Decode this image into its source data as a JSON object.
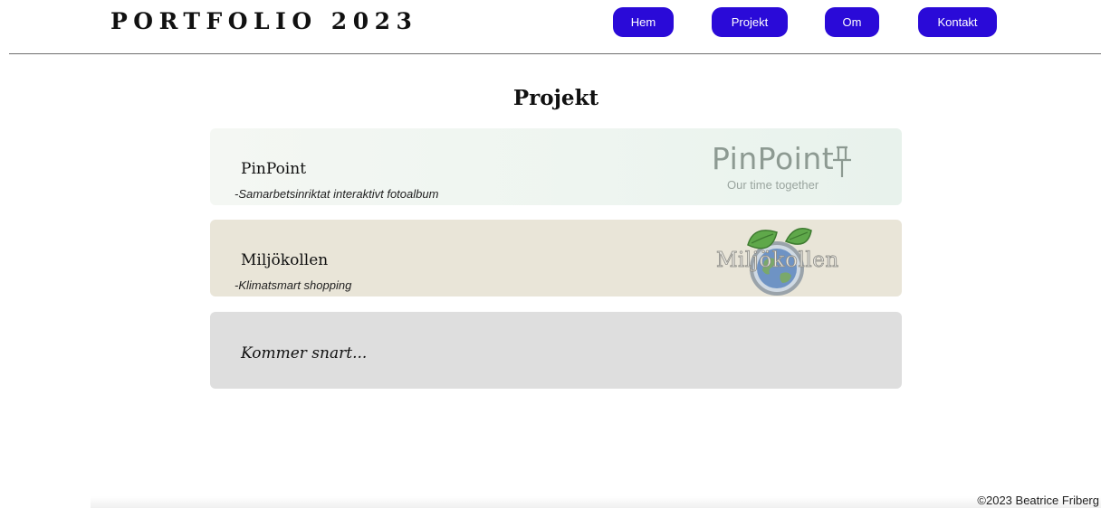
{
  "header": {
    "site_title": "PORTFOLIO 2023",
    "nav": [
      {
        "label": "Hem"
      },
      {
        "label": "Projekt"
      },
      {
        "label": "Om"
      },
      {
        "label": "Kontakt"
      }
    ]
  },
  "main": {
    "heading": "Projekt",
    "projects": [
      {
        "title": "PinPoint",
        "subtitle": "-Samarbetsinriktat interaktivt fotoalbum",
        "logo_text": "PinPoint",
        "logo_tagline": "Our time together",
        "logo_icon": "pushpin-icon"
      },
      {
        "title": "Miljökollen",
        "subtitle": "-Klimatsmart shopping",
        "logo_text": "Miljökollen",
        "logo_icon": "globe-leaves-icon"
      },
      {
        "title": "Kommer snart..."
      }
    ]
  },
  "footer": {
    "copyright": "©2023 Beatrice Friberg"
  },
  "colors": {
    "nav_button": "#2a0ad8",
    "card_pinpoint": "#eef5f0",
    "card_miljokollen": "#e9e5d8",
    "card_coming": "#dedede"
  }
}
